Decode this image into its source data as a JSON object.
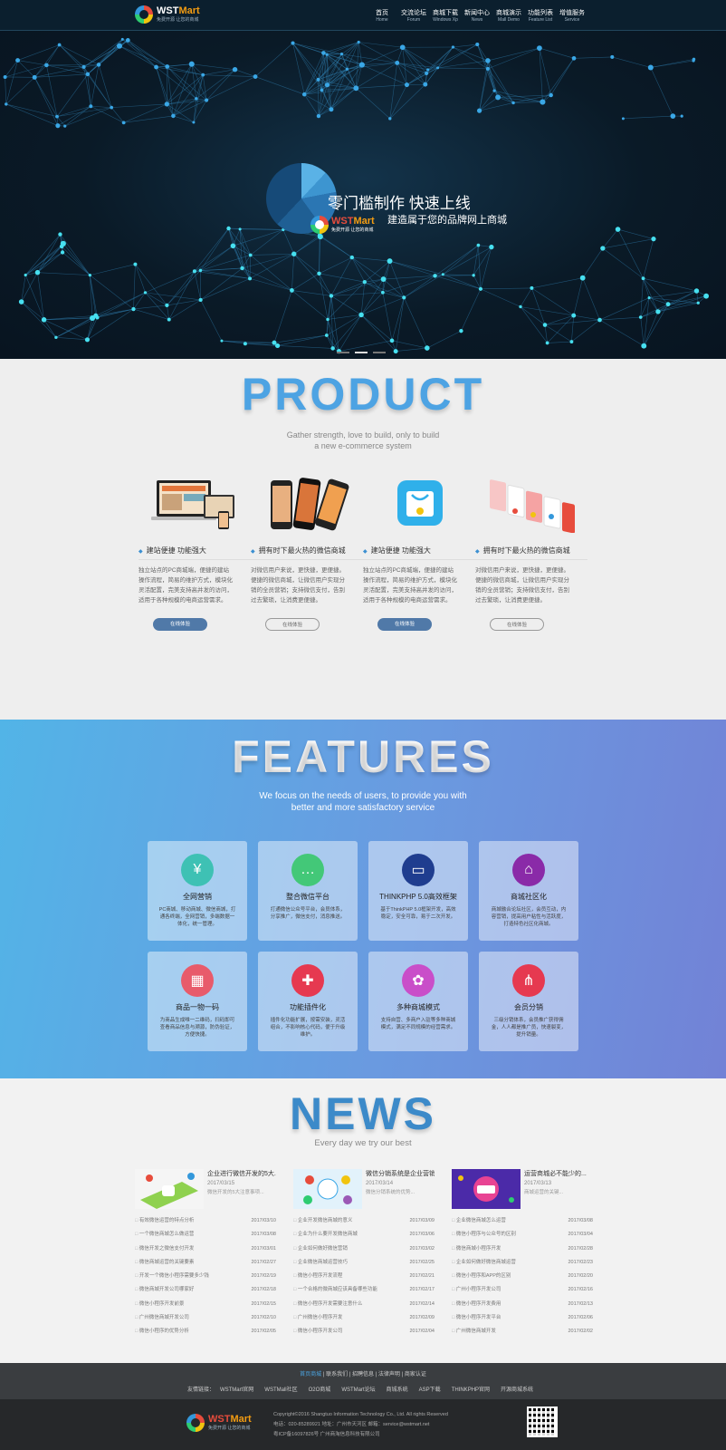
{
  "header": {
    "logo": {
      "brand_part1": "WST",
      "brand_part2": "Mart",
      "tagline": "免费开源 让您的商城"
    },
    "nav": [
      {
        "zh": "首页",
        "en": "Home"
      },
      {
        "zh": "交流论坛",
        "en": "Forum"
      },
      {
        "zh": "商城下载",
        "en": "Windows Xp"
      },
      {
        "zh": "新闻中心",
        "en": "News"
      },
      {
        "zh": "商城演示",
        "en": "Mall Demo"
      },
      {
        "zh": "功能列表",
        "en": "Feature List"
      },
      {
        "zh": "增值服务",
        "en": "Service"
      }
    ]
  },
  "hero": {
    "title": "零门槛制作 快速上线",
    "subtitle": "建造属于您的品牌网上商城",
    "logo_brand_part1": "WST",
    "logo_brand_part2": "Mart",
    "logo_tagline": "免费开源 让您的商城",
    "slides": 3,
    "active_slide": 2
  },
  "product": {
    "title": "PRODUCT",
    "subtitle_line1": "Gather strength, love to build, only to build",
    "subtitle_line2": "a new e-commerce system",
    "items": [
      {
        "heading": "建站便捷 功能强大",
        "desc": "独立站点的PC商城端，便捷的建站操作流程，简易的维护方式，模块化灵活配置，完美支持高并发的访问，适用于各种规模的电商运营需求。",
        "button": "在线体验",
        "btn_style": "filled",
        "image": "laptop-devices"
      },
      {
        "heading": "拥有时下最火热的微信商城",
        "desc": "对微信用户来说，更快捷，更便捷。便捷的微信商城，让微信用户实现分销的全员营销；支持微信支付，告别过去繁琐，让消费更便捷。",
        "button": "在线体验",
        "btn_style": "outline",
        "image": "smartphones"
      },
      {
        "heading": "建站便捷 功能强大",
        "desc": "独立站点的PC商城端，便捷的建站操作流程，简易的维护方式，模块化灵活配置，完美支持高并发的访问，适用于各种规模的电商运营需求。",
        "button": "在线体验",
        "btn_style": "filled",
        "image": "shopping-bag-app-icon"
      },
      {
        "heading": "拥有时下最火热的微信商城",
        "desc": "对微信用户来说，更快捷，更便捷。便捷的微信商城，让微信用户实现分销的全员营销；支持微信支付，告别过去繁琐，让消费更便捷。",
        "button": "在线体验",
        "btn_style": "outline",
        "image": "mobile-screens"
      }
    ]
  },
  "features": {
    "title": "FEATURES",
    "subtitle_line1": "We focus on the needs of users, to provide you with",
    "subtitle_line2": "better and more satisfactory service",
    "items": [
      {
        "name": "全网营销",
        "desc": "PC商城、移动商城、微信商城，打通各终端，全网营销，多端数据一体化，统一管理。",
        "icon": "yuan-icon",
        "color": "#3ec1b4"
      },
      {
        "name": "整合微信平台",
        "desc": "打通微信公众号平台，会员体系，分享推广，微信支付，消息推送。",
        "icon": "chat-icon",
        "color": "#43c878"
      },
      {
        "name": "THINKPHP 5.0高效框架",
        "desc": "基于ThinkPHP 5.0框架开发，高效稳定，安全可靠，易于二次开发。",
        "icon": "browser-icon",
        "color": "#1f3d8f"
      },
      {
        "name": "商城社区化",
        "desc": "商城融合论坛社区，会员互动，内容营销，提高用户粘性与活跃度，打造特色社区化商城。",
        "icon": "store-icon",
        "color": "#8a2aa8"
      },
      {
        "name": "商品一物一码",
        "desc": "为商品生成唯一二维码，扫码即可查看商品信息与溯源，防伪验证，方便快捷。",
        "icon": "qrcode-icon",
        "color": "#e85b6b"
      },
      {
        "name": "功能插件化",
        "desc": "插件化功能扩展，按需安装，灵活组合，不影响核心代码，便于升级维护。",
        "icon": "puzzle-icon",
        "color": "#e63950"
      },
      {
        "name": "多种商城模式",
        "desc": "支持自营、多商户入驻等多种商城模式，满足不同规模的经营需求。",
        "icon": "grid-icon",
        "color": "#c94ec9"
      },
      {
        "name": "会员分销",
        "desc": "三级分销体系，会员推广获得佣金，人人都是推广员，快速裂变，提升销量。",
        "icon": "network-icon",
        "color": "#e63950"
      }
    ]
  },
  "news": {
    "title": "NEWS",
    "subtitle": "Every day we try our best",
    "columns": [
      {
        "top": {
          "title": "企业进行微信开发的5大...",
          "date": "2017/03/15",
          "summary": "微信开发的5大注意事项...",
          "thumb": "green-app-thumb"
        },
        "items": [
          {
            "title": "有效微信运营的特点分析",
            "date": "2017/03/10"
          },
          {
            "title": "一个微信商城怎么做运营",
            "date": "2017/03/08"
          },
          {
            "title": "微信开发之微信支付开发",
            "date": "2017/03/01"
          },
          {
            "title": "微信商城运营的关键要素",
            "date": "2017/02/27"
          },
          {
            "title": "开发一个微信小程序需要多少钱",
            "date": "2017/02/19"
          },
          {
            "title": "微信商城开发公司哪家好",
            "date": "2017/02/18"
          },
          {
            "title": "微信小程序开发前景",
            "date": "2017/02/15"
          },
          {
            "title": "广州微信商城开发公司",
            "date": "2017/02/10"
          },
          {
            "title": "微信小程序的优势分析",
            "date": "2017/02/05"
          }
        ]
      },
      {
        "top": {
          "title": "微信分销系统是企业营销...",
          "date": "2017/03/14",
          "summary": "微信分销系统的优势...",
          "thumb": "circles-thumb"
        },
        "items": [
          {
            "title": "企业开发微信商城的意义",
            "date": "2017/03/09"
          },
          {
            "title": "企业为什么要开发微信商城",
            "date": "2017/03/06"
          },
          {
            "title": "企业如何做好微信营销",
            "date": "2017/03/02"
          },
          {
            "title": "企业微信商城运营技巧",
            "date": "2017/02/25"
          },
          {
            "title": "微信小程序开发流程",
            "date": "2017/02/21"
          },
          {
            "title": "一个合格的微商城应该具备哪些功能",
            "date": "2017/02/17"
          },
          {
            "title": "微信小程序开发需要注意什么",
            "date": "2017/02/14"
          },
          {
            "title": "广州微信小程序开发",
            "date": "2017/02/09"
          },
          {
            "title": "微信小程序开发公司",
            "date": "2017/02/04"
          }
        ]
      },
      {
        "top": {
          "title": "运营商城必不能少的...",
          "date": "2017/03/13",
          "summary": "商城运营的关键...",
          "thumb": "shop-app-thumb"
        },
        "items": [
          {
            "title": "企业微信商城怎么运营",
            "date": "2017/03/08"
          },
          {
            "title": "微信小程序与公众号的区别",
            "date": "2017/03/04"
          },
          {
            "title": "微信商城小程序开发",
            "date": "2017/02/28"
          },
          {
            "title": "企业如何做好微信商城运营",
            "date": "2017/02/23"
          },
          {
            "title": "微信小程序和APP的区别",
            "date": "2017/02/20"
          },
          {
            "title": "广州小程序开发公司",
            "date": "2017/02/16"
          },
          {
            "title": "微信小程序开发费用",
            "date": "2017/02/13"
          },
          {
            "title": "微信小程序开发平台",
            "date": "2017/02/06"
          },
          {
            "title": "广州微信商城开发",
            "date": "2017/02/02"
          }
        ]
      }
    ]
  },
  "footer": {
    "links_row1": [
      "首页商城",
      "联系我们",
      "招聘信息",
      "法律声明",
      "商家认证"
    ],
    "links_row2_label": "友情链接：",
    "links_row2": [
      "WSTMart官网",
      "WSTMall社区",
      "O2O商城",
      "WSTMart论坛",
      "商城系统",
      "ASP下载",
      "THINKPHP官网",
      "开源商城系统"
    ],
    "logo_brand_part1": "WST",
    "logo_brand_part2": "Mart",
    "logo_tagline": "免费开源 让您的商城",
    "copyright": "Copyright©2016 Shangtuo Information Technology Co., Ltd. All rights Reserved",
    "contact": "电话：020-85289921  地址：广州市天河区  邮箱：service@wstmart.net",
    "icp": "粤ICP备16097826号  广州商淘信息科技有限公司"
  }
}
